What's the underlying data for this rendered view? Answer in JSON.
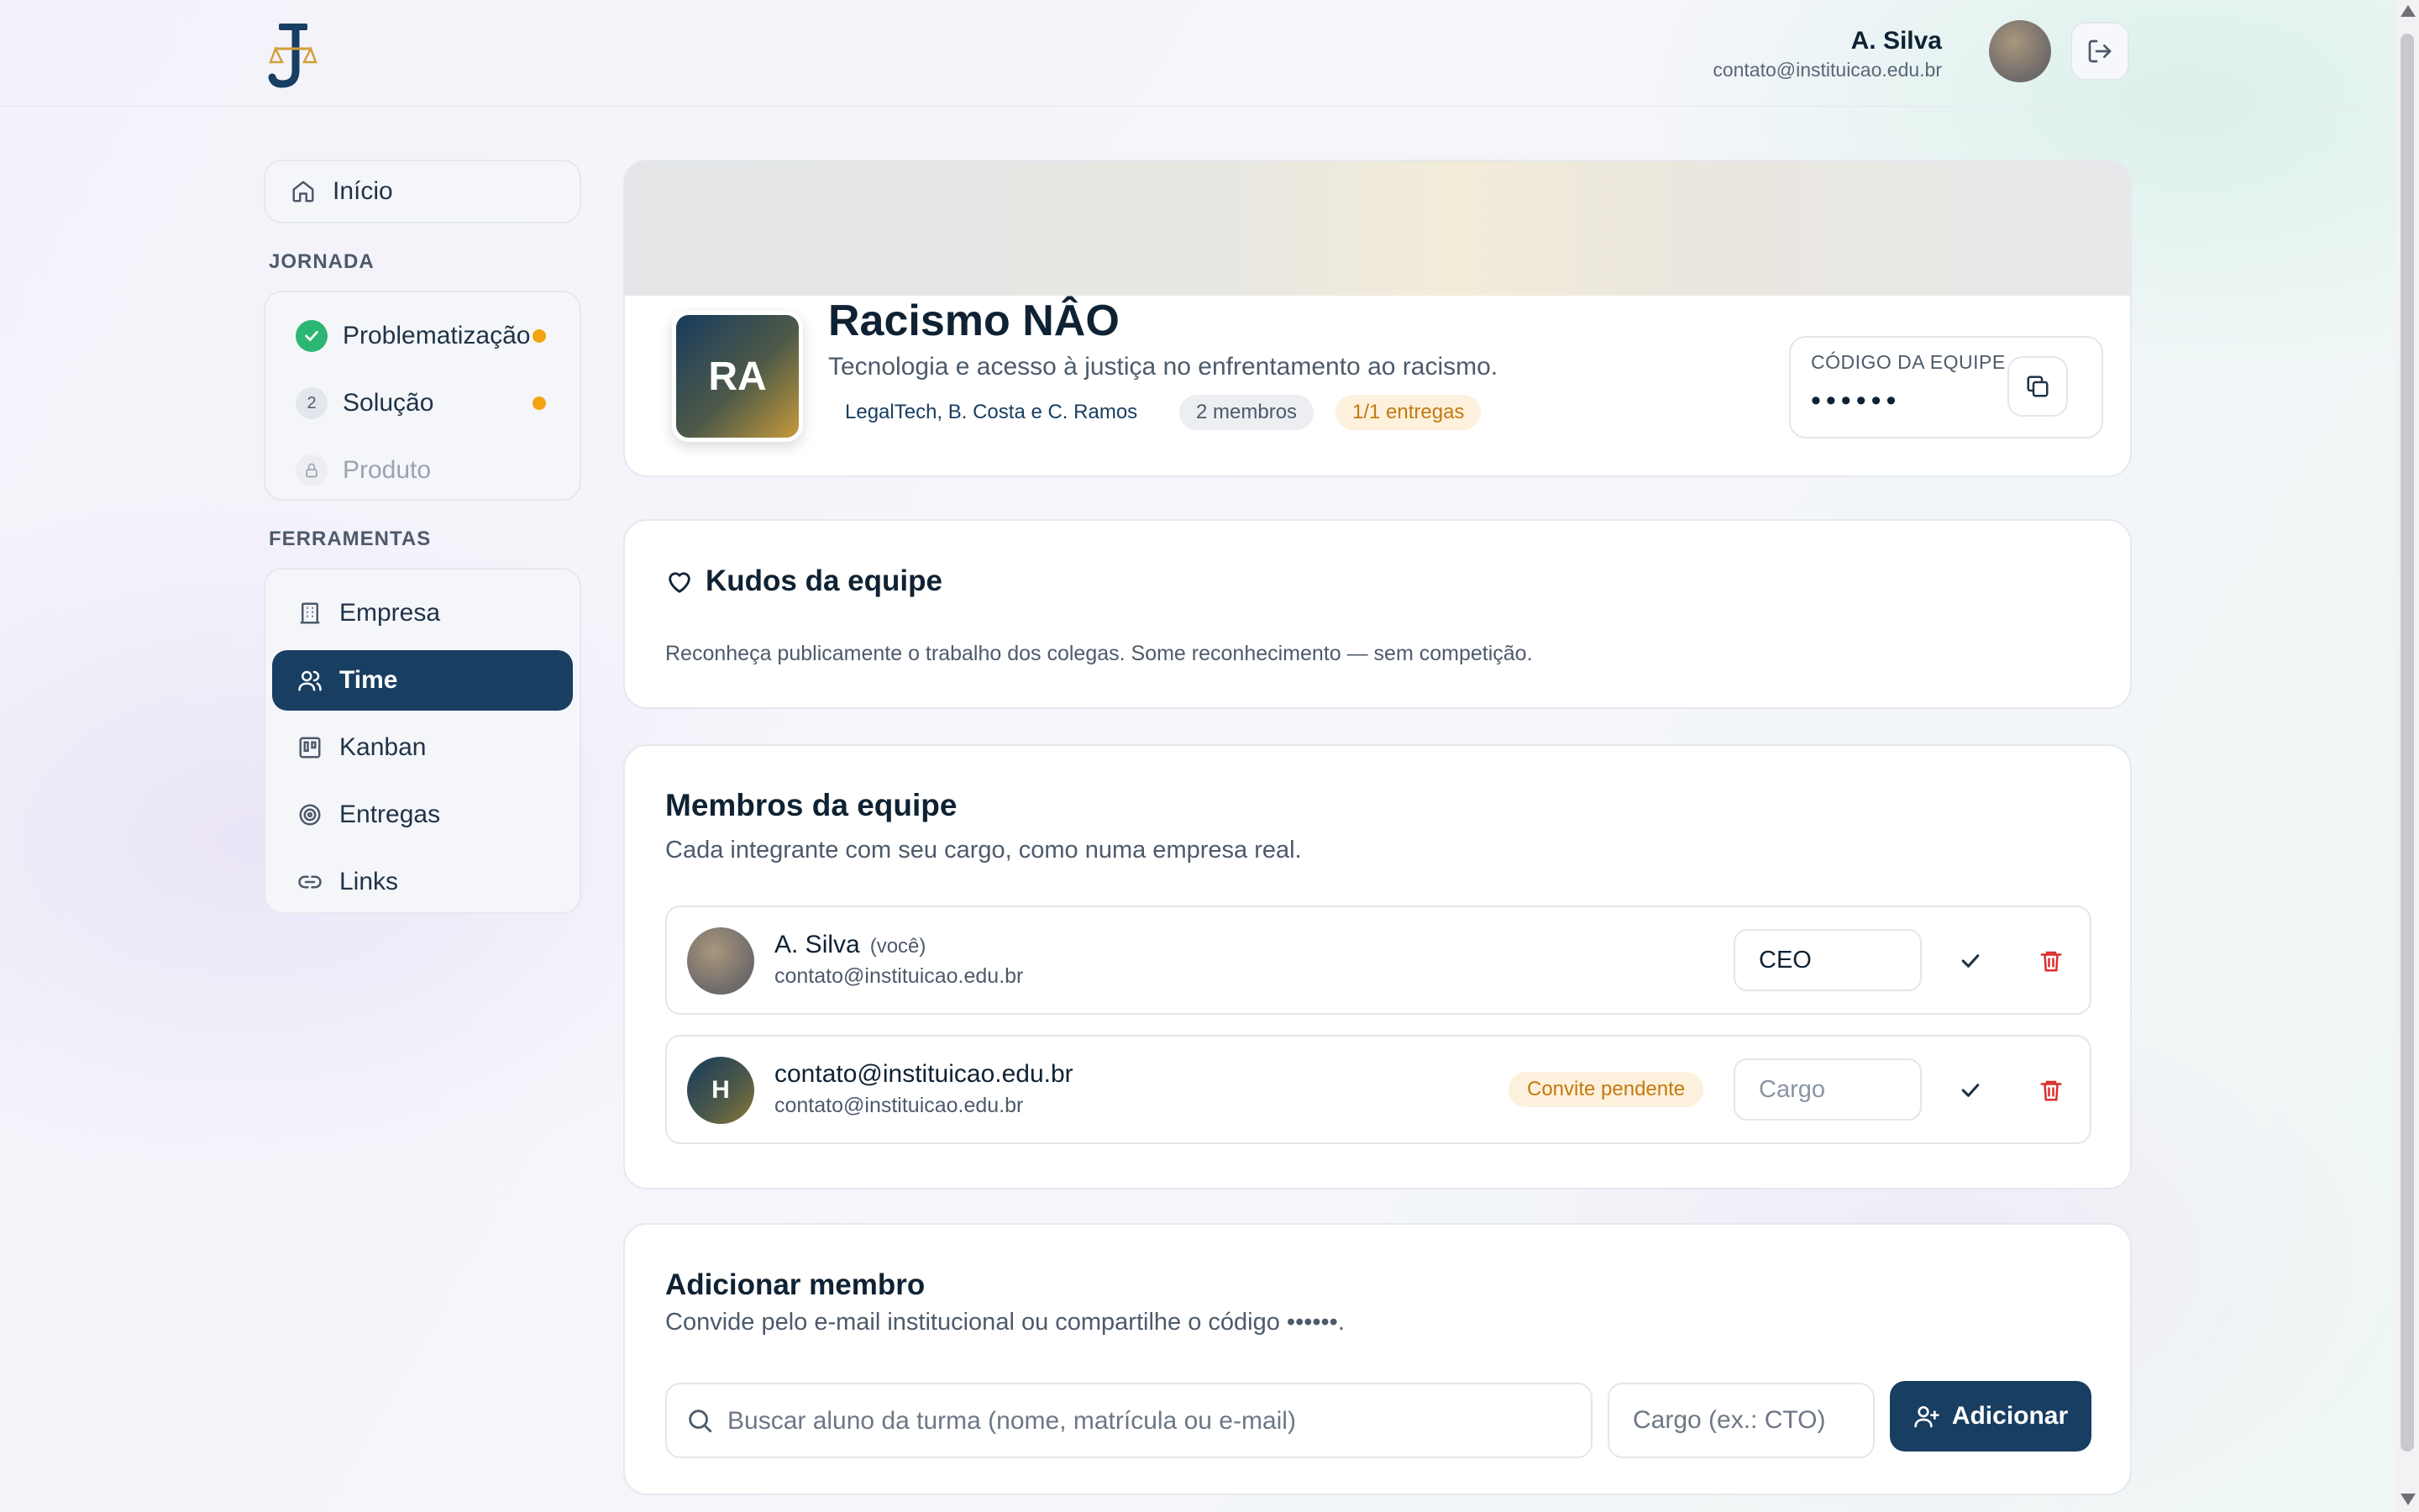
{
  "header": {
    "user_name": "A. Silva",
    "user_email": "contato@instituicao.edu.br"
  },
  "sidebar": {
    "home_label": "Início",
    "journey_heading": "JORNADA",
    "journey": [
      {
        "label": "Problematização",
        "status": "done"
      },
      {
        "label": "Solução",
        "step": "2",
        "status": "pending"
      },
      {
        "label": "Produto",
        "status": "locked"
      }
    ],
    "tools_heading": "FERRAMENTAS",
    "tools": [
      {
        "label": "Empresa"
      },
      {
        "label": "Time",
        "active": true
      },
      {
        "label": "Kanban"
      },
      {
        "label": "Entregas"
      },
      {
        "label": "Links"
      }
    ]
  },
  "team": {
    "initials": "RA",
    "name": "Racismo NÂO",
    "tagline": "Tecnologia e acesso à justiça no enfrentamento ao racismo.",
    "tags": [
      "LegalTech, B. Costa e C. Ramos",
      "2 membros",
      "1/1 entregas"
    ],
    "code_label": "CÓDIGO DA EQUIPE",
    "code_value": "••••••"
  },
  "kudos": {
    "title": "Kudos da equipe",
    "description": "Reconheça publicamente o trabalho dos colegas. Some reconhecimento — sem competição."
  },
  "members": {
    "title": "Membros da equipe",
    "description": "Cada integrante com seu cargo, como numa empresa real.",
    "rows": [
      {
        "name": "A. Silva",
        "you_tag": "(você)",
        "email": "contato@instituicao.edu.br",
        "role": "CEO",
        "role_placeholder": "Cargo"
      },
      {
        "initial": "H",
        "name": "contato@instituicao.edu.br",
        "email": "contato@instituicao.edu.br",
        "badge": "Convite pendente",
        "role": "",
        "role_placeholder": "Cargo"
      }
    ]
  },
  "add_member": {
    "title": "Adicionar membro",
    "description": "Convide pelo e-mail institucional ou compartilhe o código ••••••.",
    "search_placeholder": "Buscar aluno da turma (nome, matrícula ou e-mail)",
    "role_placeholder": "Cargo (ex.: CTO)",
    "button_label": "Adicionar"
  },
  "colors": {
    "primary": "#183e62",
    "success": "#2bb673",
    "warning": "#f2a312",
    "danger": "#d92d2d"
  }
}
